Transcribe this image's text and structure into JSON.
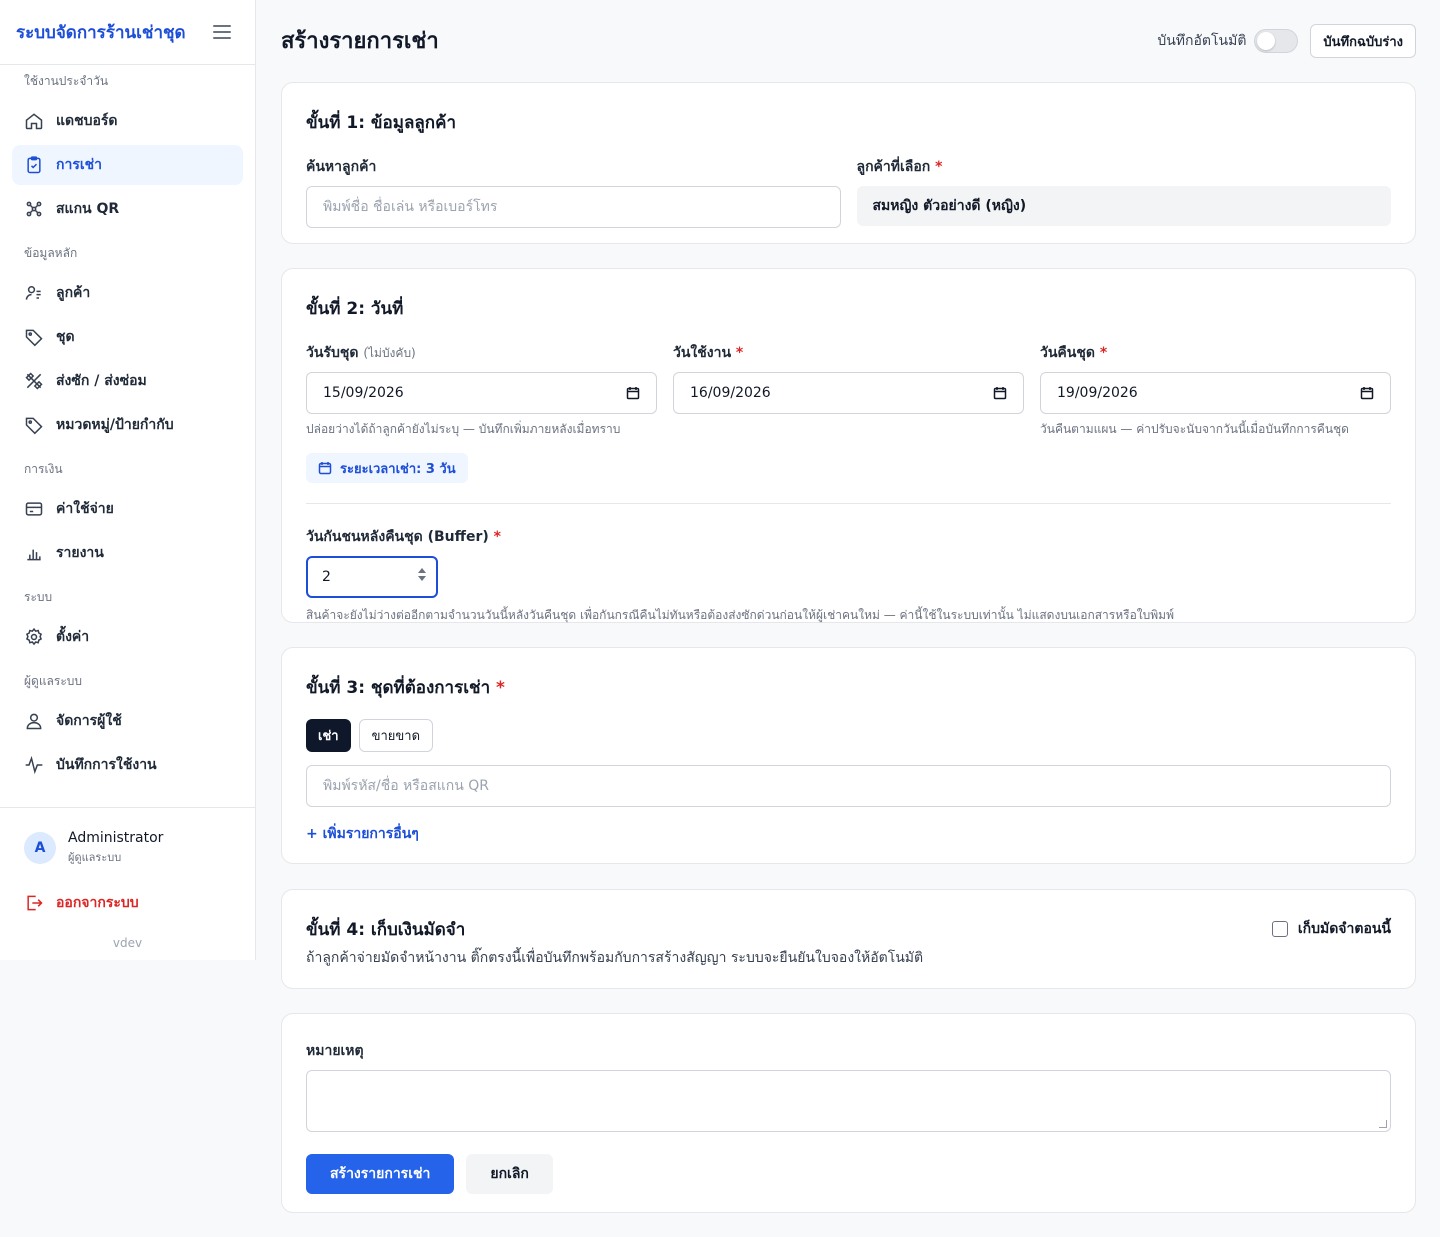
{
  "sidebar": {
    "brand": "ระบบจัดการร้านเช่าชุด",
    "sections": [
      {
        "title": "ใช้งานประจำวัน",
        "items": [
          {
            "label": "แดชบอร์ด",
            "icon": "home-icon"
          },
          {
            "label": "การเช่า",
            "icon": "clipboard-icon"
          },
          {
            "label": "สแกน QR",
            "icon": "qr-scan-icon"
          }
        ]
      },
      {
        "title": "ข้อมูลหลัก",
        "items": [
          {
            "label": "ลูกค้า",
            "icon": "customers-icon"
          },
          {
            "label": "ชุด",
            "icon": "tag-icon"
          },
          {
            "label": "ส่งซัก / ส่งซ่อม",
            "icon": "tools-icon"
          },
          {
            "label": "หมวดหมู่/ป้ายกำกับ",
            "icon": "label-icon"
          }
        ]
      },
      {
        "title": "การเงิน",
        "items": [
          {
            "label": "ค่าใช้จ่าย",
            "icon": "credit-card-icon"
          },
          {
            "label": "รายงาน",
            "icon": "bar-chart-icon"
          }
        ]
      },
      {
        "title": "ระบบ",
        "items": [
          {
            "label": "ตั้งค่า",
            "icon": "gear-icon"
          }
        ]
      },
      {
        "title": "ผู้ดูแลระบบ",
        "items": [
          {
            "label": "จัดการผู้ใช้",
            "icon": "user-icon"
          },
          {
            "label": "บันทึกการใช้งาน",
            "icon": "activity-icon"
          }
        ]
      }
    ],
    "user": {
      "initial": "A",
      "name": "Administrator",
      "role": "ผู้ดูแลระบบ"
    },
    "logout": "ออกจากระบบ",
    "version": "vdev"
  },
  "header": {
    "title": "สร้างรายการเช่า",
    "autosave_label": "บันทึกอัตโนมัติ",
    "autosave_on": false,
    "save_draft": "บันทึกฉบับร่าง"
  },
  "step1": {
    "title": "ขั้นที่ 1: ข้อมูลลูกค้า",
    "search_label": "ค้นหาลูกค้า",
    "search_placeholder": "พิมพ์ชื่อ ชื่อเล่น หรือเบอร์โทร",
    "selected_label": "ลูกค้าที่เลือก",
    "selected_value": "สมหญิง ตัวอย่างดี (หญิง)"
  },
  "step2": {
    "title": "ขั้นที่ 2: วันที่",
    "pickup_label": "วันรับชุด",
    "pickup_optional": "(ไม่บังคับ)",
    "pickup_value": "15/09/2026",
    "pickup_hint": "ปล่อยว่างได้ถ้าลูกค้ายังไม่ระบุ — บันทึกเพิ่มภายหลังเมื่อทราบ",
    "use_label": "วันใช้งาน",
    "use_value": "16/09/2026",
    "return_label": "วันคืนชุด",
    "return_value": "19/09/2026",
    "return_hint": "วันคืนตามแผน — ค่าปรับจะนับจากวันนี้เมื่อบันทึกการคืนชุด",
    "duration": "ระยะเวลาเช่า: 3 วัน",
    "buffer_label": "วันกันชนหลังคืนชุด (Buffer)",
    "buffer_value": "2",
    "buffer_hint": "สินค้าจะยังไม่ว่างต่ออีกตามจำนวนวันนี้หลังวันคืนชุด เพื่อกันกรณีคืนไม่ทันหรือต้องส่งซักด่วนก่อนให้ผู้เช่าคนใหม่ — ค่านี้ใช้ในระบบเท่านั้น ไม่แสดงบนเอกสารหรือใบพิมพ์"
  },
  "step3": {
    "title": "ขั้นที่ 3: ชุดที่ต้องการเช่า",
    "mode_rent": "เช่า",
    "mode_sell": "ขายขาด",
    "search_placeholder": "พิมพ์รหัส/ชื่อ หรือสแกน QR",
    "add_more": "+ เพิ่มรายการอื่นๆ"
  },
  "step4": {
    "title": "ขั้นที่ 4: เก็บเงินมัดจำ",
    "description": "ถ้าลูกค้าจ่ายมัดจำหน้างาน ติ๊กตรงนี้เพื่อบันทึกพร้อมกับการสร้างสัญญา ระบบจะยืนยันใบจองให้อัตโนมัติ",
    "checkbox_label": "เก็บมัดจำตอนนี้",
    "checked": false
  },
  "notes": {
    "label": "หมายเหตุ",
    "value": "",
    "submit": "สร้างรายการเช่า",
    "cancel": "ยกเลิก"
  },
  "colors": {
    "brand": "#1d4ed8",
    "primary_button": "#2563eb",
    "danger": "#dc2626"
  }
}
